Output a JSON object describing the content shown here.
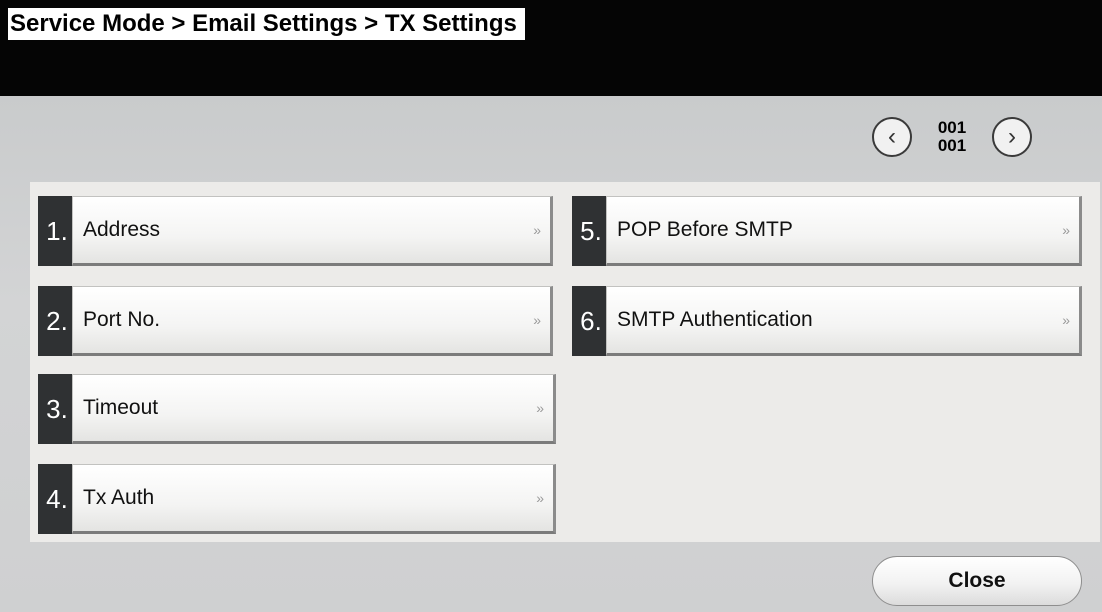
{
  "header": {
    "breadcrumb": "Service Mode > Email Settings > TX Settings"
  },
  "pager": {
    "prev_icon": "‹",
    "next_icon": "›",
    "current_page": "001",
    "total_pages": "001"
  },
  "menu": {
    "items": [
      {
        "number": "1.",
        "label": "Address",
        "arrow": "»"
      },
      {
        "number": "2.",
        "label": "Port No.",
        "arrow": "»"
      },
      {
        "number": "3.",
        "label": "Timeout",
        "arrow": "»"
      },
      {
        "number": "4.",
        "label": "Tx Auth",
        "arrow": "»"
      },
      {
        "number": "5.",
        "label": "POP Before SMTP",
        "arrow": "»"
      },
      {
        "number": "6.",
        "label": "SMTP Authentication",
        "arrow": "»"
      }
    ]
  },
  "footer": {
    "close_label": "Close"
  }
}
